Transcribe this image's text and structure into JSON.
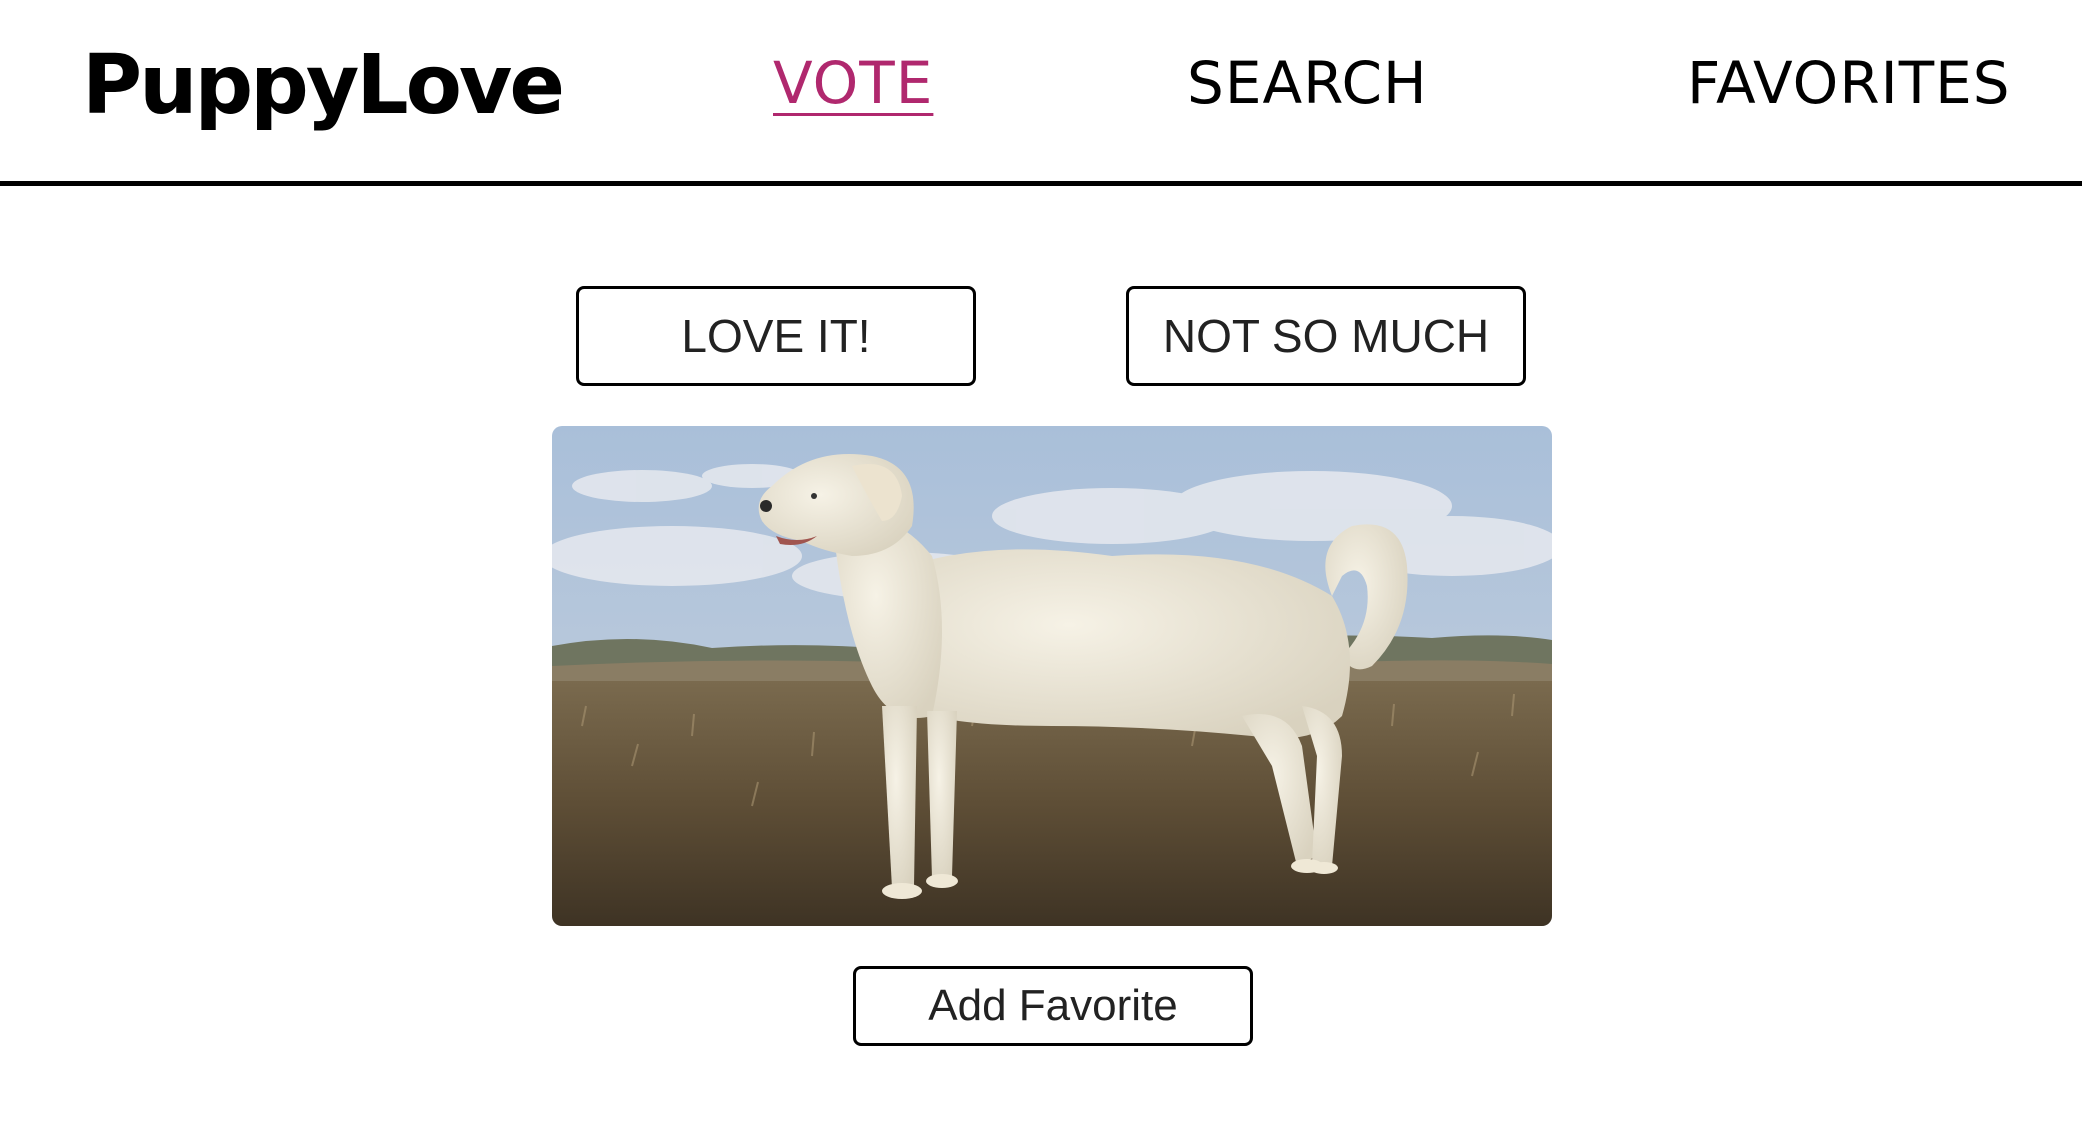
{
  "header": {
    "logo": "PuppyLove",
    "nav": [
      {
        "label": "VOTE",
        "active": true
      },
      {
        "label": "SEARCH",
        "active": false
      },
      {
        "label": "FAVORITES",
        "active": false
      }
    ]
  },
  "main": {
    "love_label": "LOVE IT!",
    "not_so_much_label": "NOT SO MUCH",
    "add_favorite_label": "Add Favorite",
    "photo": {
      "subject": "white dog standing in a grassy field",
      "alt": ""
    }
  },
  "colors": {
    "accent": "#b0286e",
    "text": "#000000",
    "background": "#ffffff"
  }
}
